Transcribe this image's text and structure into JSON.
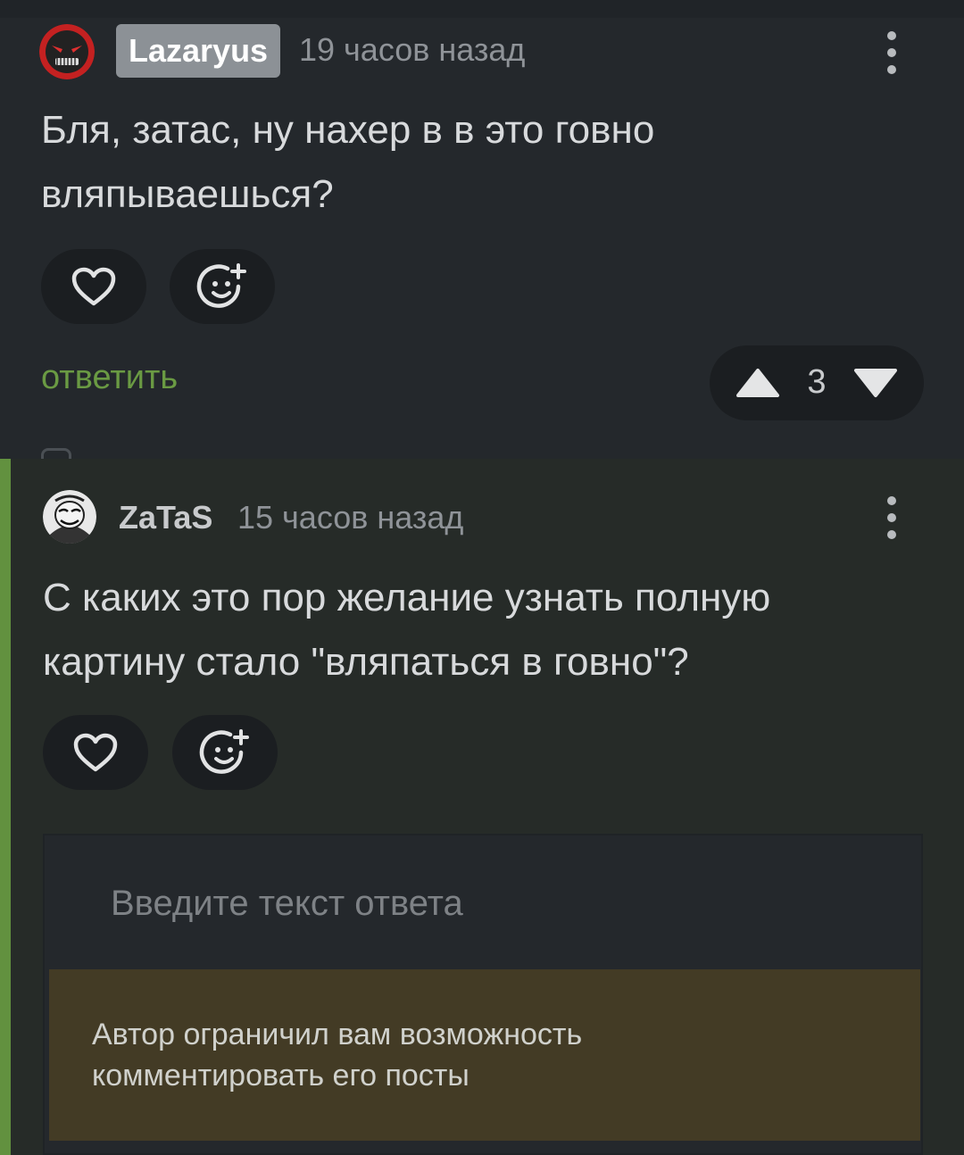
{
  "comment1": {
    "author": "Lazaryus",
    "time": "19 часов назад",
    "text": "Бля, затас, ну нахер в в это говно вляпываешься?",
    "reply_label": "ответить",
    "score": "3"
  },
  "comment2": {
    "author": "ZaTaS",
    "time": "15 часов назад",
    "text": "С каких это пор желание узнать полную картину стало \"вляпаться в говно\"?"
  },
  "reply_form": {
    "placeholder": "Введите текст ответа",
    "restriction_notice": "Автор ограничил вам возможность комментировать его посты"
  },
  "icons": {
    "like": "heart-icon",
    "react": "emoji-add-icon",
    "menu": "more-vertical-icon",
    "upvote": "triangle-up-icon",
    "downvote": "triangle-down-icon"
  },
  "colors": {
    "background": "#24282c",
    "accent_green": "#62913f",
    "reply_link": "#6a9a43",
    "warning_bg": "#433b25",
    "author_badge": "#8c9196"
  }
}
